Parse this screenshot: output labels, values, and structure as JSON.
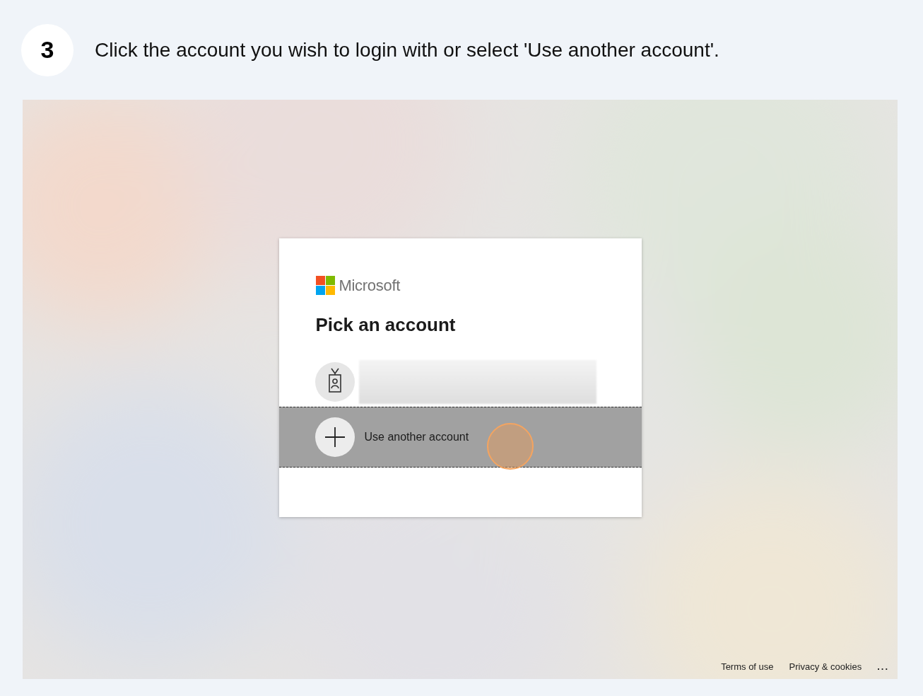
{
  "step": {
    "number": "3",
    "instruction": "Click the account you wish to login with or select 'Use another account'."
  },
  "screenshot": {
    "dialog": {
      "brand": "Microsoft",
      "title": "Pick an account",
      "options": [
        {
          "kind": "account",
          "highlighted": false
        },
        {
          "kind": "add",
          "label": "Use another account",
          "highlighted": true,
          "clicked": true
        }
      ]
    },
    "footer_links": [
      "Terms of use",
      "Privacy & cookies",
      "..."
    ]
  }
}
